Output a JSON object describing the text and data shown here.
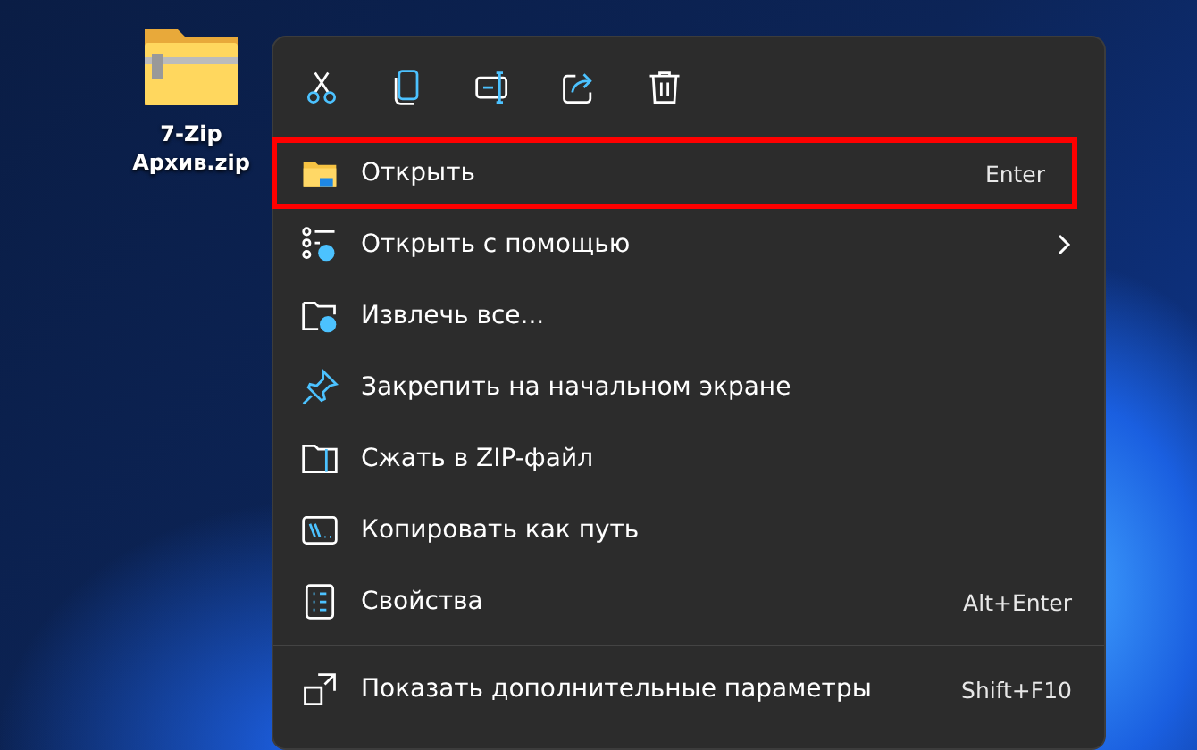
{
  "desktop_icon": {
    "label": "7-Zip Архив.zip"
  },
  "toolbar": [
    {
      "kind": "cut"
    },
    {
      "kind": "copy"
    },
    {
      "kind": "rename"
    },
    {
      "kind": "share"
    },
    {
      "kind": "delete"
    }
  ],
  "menu_items": [
    {
      "kind": "open",
      "label": "Открыть",
      "shortcut": "Enter",
      "submenu": false,
      "selected": true
    },
    {
      "kind": "open-with",
      "label": "Открыть с помощью",
      "submenu": true,
      "selected": false
    },
    {
      "kind": "extract",
      "label": "Извлечь все...",
      "submenu": false,
      "selected": false
    },
    {
      "kind": "pin",
      "label": "Закрепить на начальном экране",
      "submenu": false,
      "selected": false
    },
    {
      "kind": "zip",
      "label": "Сжать в ZIP-файл",
      "submenu": false,
      "selected": false
    },
    {
      "kind": "copy-path",
      "label": "Копировать как путь",
      "submenu": false,
      "selected": false
    },
    {
      "kind": "properties",
      "label": "Свойства",
      "shortcut": "Alt+Enter",
      "submenu": false,
      "selected": false
    }
  ],
  "footer_item": {
    "kind": "more",
    "label": "Показать дополнительные параметры",
    "shortcut": "Shift+F10",
    "submenu": false,
    "selected": false
  }
}
